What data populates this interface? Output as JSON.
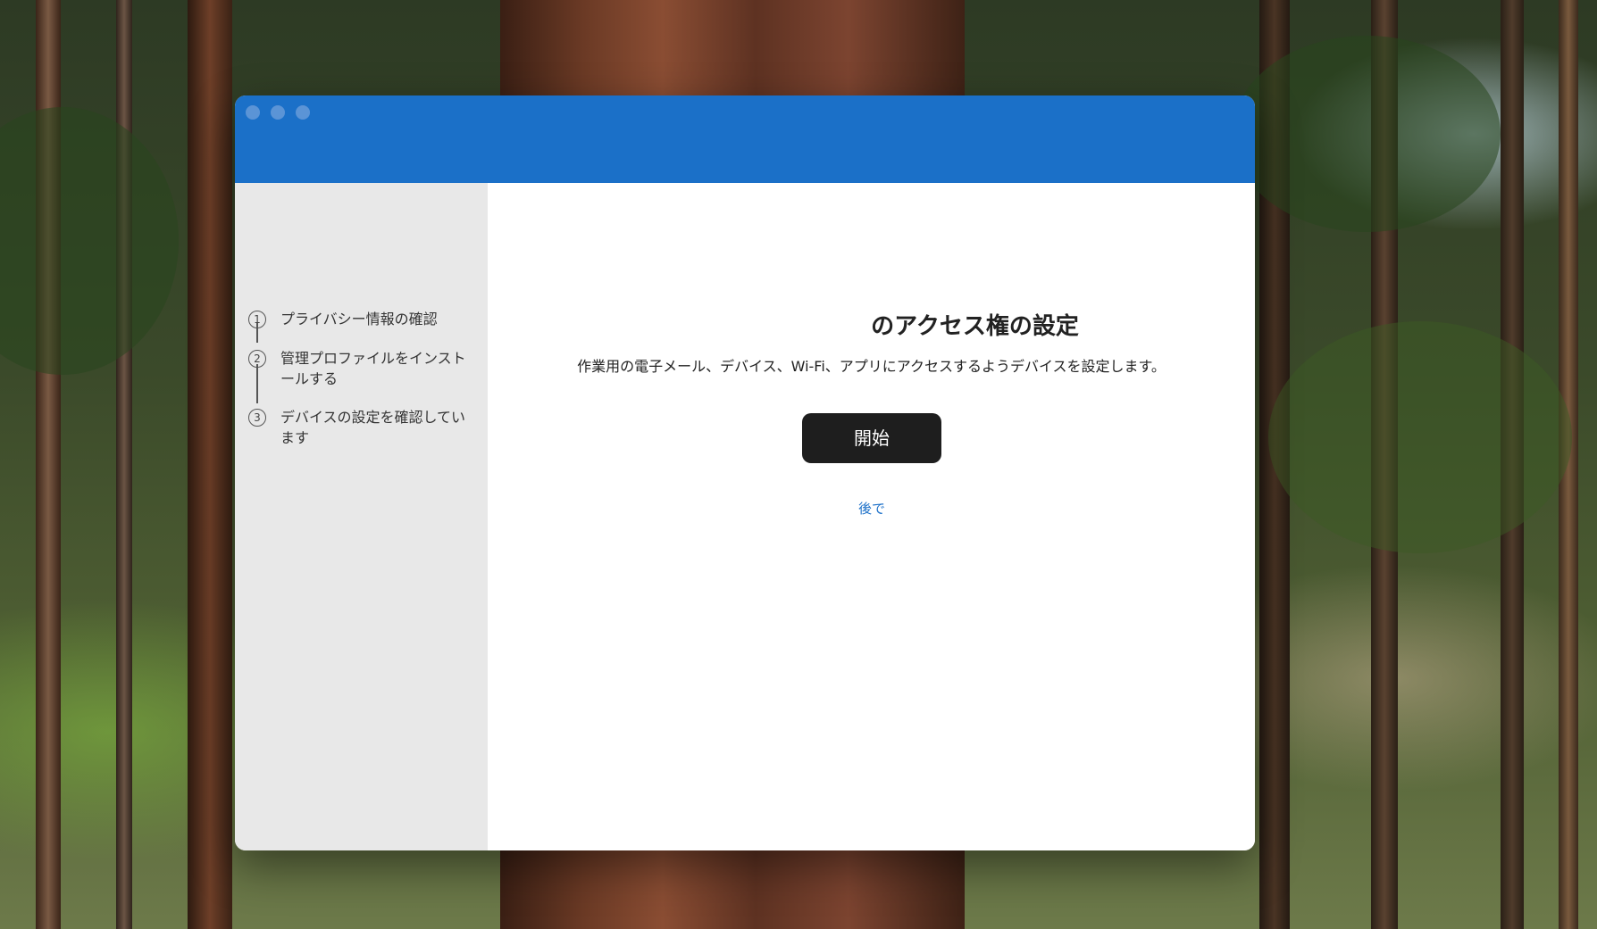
{
  "window": {
    "title": ""
  },
  "sidebar": {
    "steps": [
      {
        "number": "1",
        "label": "プライバシー情報の確認"
      },
      {
        "number": "2",
        "label": "管理プロファイルをインストールする"
      },
      {
        "number": "3",
        "label": "デバイスの設定を確認しています"
      }
    ]
  },
  "main": {
    "title": "のアクセス権の設定",
    "description": "作業用の電子メール、デバイス、Wi-Fi、アプリにアクセスするようデバイスを設定します。",
    "start_button": "開始",
    "later_link": "後で"
  },
  "colors": {
    "titlebar": "#1b70c8",
    "sidebar_bg": "#e8e8e8",
    "primary_button": "#1e1e1e",
    "link": "#1a6fc8"
  }
}
